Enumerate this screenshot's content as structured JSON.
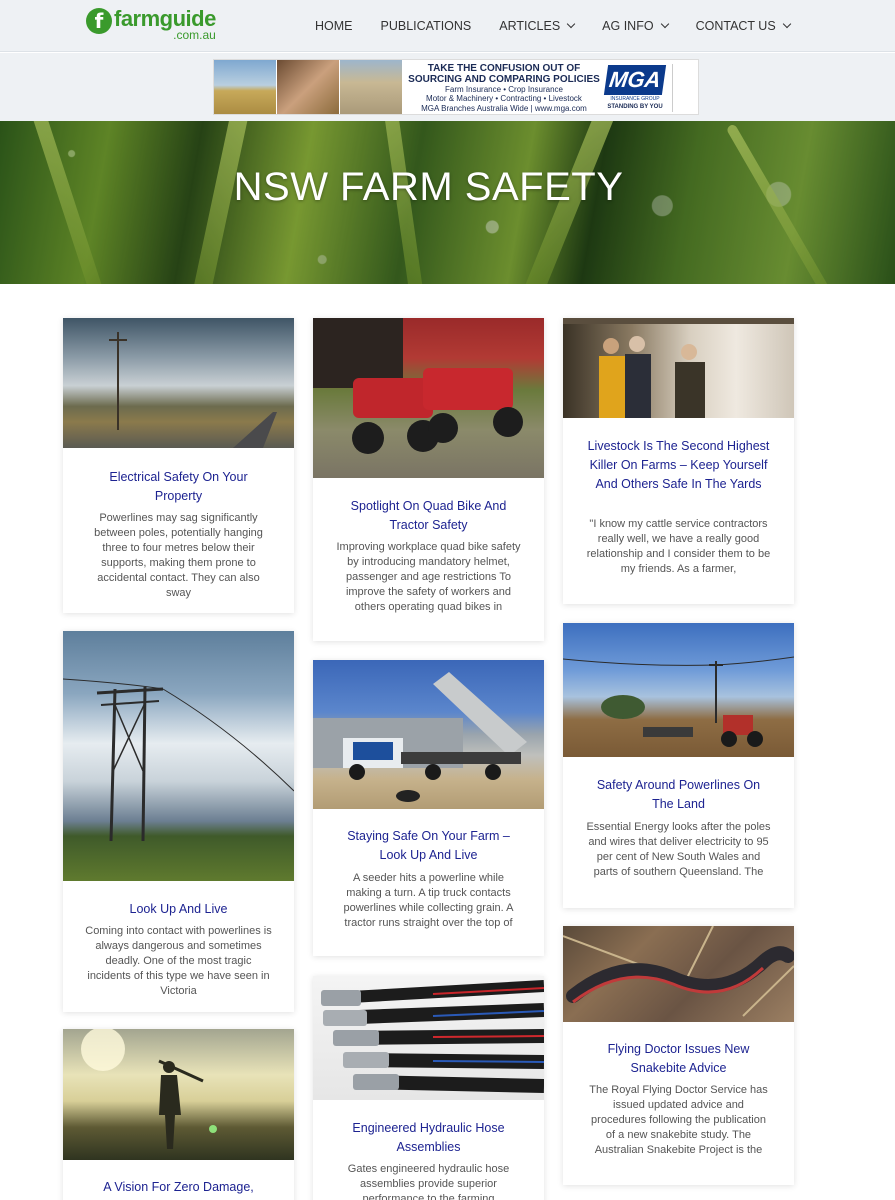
{
  "brand": {
    "name": "farmguide",
    "domain": ".com.au",
    "mark": "f",
    "color": "#3a9a2c"
  },
  "nav": [
    {
      "label": "HOME",
      "dropdown": false
    },
    {
      "label": "PUBLICATIONS",
      "dropdown": false
    },
    {
      "label": "ARTICLES",
      "dropdown": true
    },
    {
      "label": "AG INFO",
      "dropdown": true
    },
    {
      "label": "CONTACT US",
      "dropdown": true
    }
  ],
  "ad": {
    "headline_1": "TAKE THE CONFUSION OUT OF",
    "headline_2": "SOURCING AND COMPARING POLICIES",
    "services_1": "Farm Insurance • Crop Insurance",
    "services_2": "Motor & Machinery • Contracting • Livestock",
    "footer": "MGA Branches Australia Wide | www.mga.com",
    "logo": "MGA",
    "logo_sub": "INSURANCE GROUP",
    "tagline": "STANDING BY YOU"
  },
  "hero": {
    "title": "NSW FARM SAFETY"
  },
  "articles": [
    {
      "title": "Electrical Safety On Your Property",
      "excerpt": "Powerlines may sag significantly between poles, potentially hanging three to four metres below their supports, making them prone to accidental contact. They can also sway"
    },
    {
      "title": "Spotlight On Quad Bike And Tractor Safety",
      "excerpt": "Improving workplace quad bike safety by introducing mandatory helmet, passenger and age restrictions To improve the safety of workers and others operating quad bikes in"
    },
    {
      "title": "Livestock Is The Second Highest Killer On Farms – Keep Yourself And Others Safe In The Yards",
      "excerpt": "\"I know my cattle service contractors really well, we have a really good relationship and I consider them to be my friends. As a farmer,"
    },
    {
      "title": "Look Up And Live",
      "excerpt": "Coming into contact with powerlines is always dangerous and sometimes deadly. One of the most tragic incidents of this type we have seen in Victoria"
    },
    {
      "title": "Staying Safe On Your Farm – Look Up And Live",
      "excerpt": "A seeder hits a powerline while making a turn. A tip truck contacts powerlines while collecting grain. A tractor runs straight over the top of"
    },
    {
      "title": "Safety Around Powerlines On The Land",
      "excerpt": "Essential Energy looks after the poles and wires that deliver electricity to 95 per cent of New South Wales and parts of southern Queensland. The"
    },
    {
      "title": "A Vision For Zero Damage,",
      "excerpt": ""
    },
    {
      "title": "Engineered Hydraulic Hose Assemblies",
      "excerpt": "Gates engineered hydraulic hose assemblies provide superior performance to the farming"
    },
    {
      "title": "Flying Doctor Issues New Snakebite Advice",
      "excerpt": "The Royal Flying Doctor Service has issued updated advice and procedures following the publication of a new snakebite study. The Australian Snakebite Project is the"
    }
  ]
}
